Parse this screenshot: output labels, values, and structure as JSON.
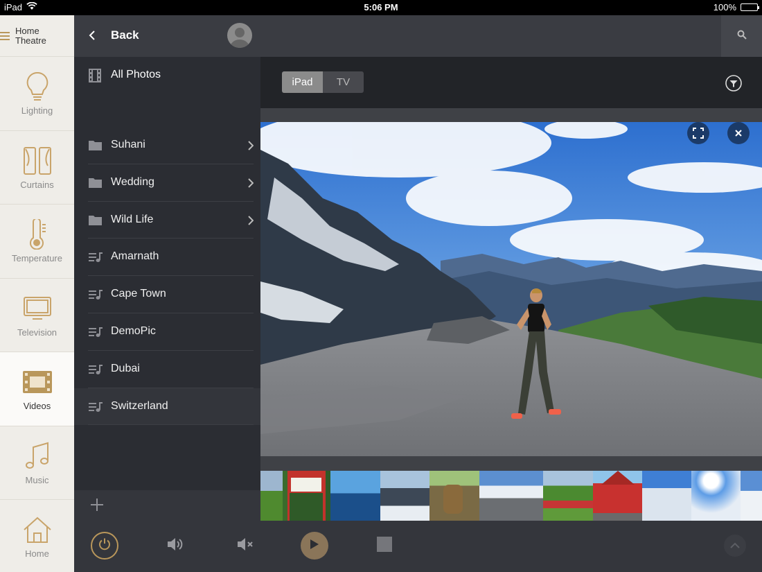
{
  "status_bar": {
    "device": "iPad",
    "time": "5:06 PM",
    "battery": "100%"
  },
  "rail": {
    "home_label": "Home\nTheatre",
    "items": [
      {
        "label": "Lighting",
        "icon": "lightbulb-icon"
      },
      {
        "label": "Curtains",
        "icon": "curtains-icon"
      },
      {
        "label": "Temperature",
        "icon": "thermometer-icon"
      },
      {
        "label": "Television",
        "icon": "television-icon"
      },
      {
        "label": "Videos",
        "icon": "film-icon"
      },
      {
        "label": "Music",
        "icon": "music-note-icon"
      },
      {
        "label": "Home",
        "icon": "home-icon"
      }
    ],
    "active": "Videos"
  },
  "panel": {
    "back_label": "Back",
    "all_photos_label": "All Photos",
    "list": [
      {
        "label": "Suhani",
        "type": "folder",
        "has_children": true
      },
      {
        "label": "Wedding",
        "type": "folder",
        "has_children": true
      },
      {
        "label": "Wild Life",
        "type": "folder",
        "has_children": true
      },
      {
        "label": "Amarnath",
        "type": "playlist",
        "has_children": false
      },
      {
        "label": "Cape Town",
        "type": "playlist",
        "has_children": false
      },
      {
        "label": "DemoPic",
        "type": "playlist",
        "has_children": false
      },
      {
        "label": "Dubai",
        "type": "playlist",
        "has_children": false
      },
      {
        "label": "Switzerland",
        "type": "playlist",
        "has_children": false
      }
    ],
    "selected": "Switzerland"
  },
  "toolbar": {
    "segments": [
      "iPad",
      "TV"
    ],
    "selected_segment": "iPad"
  },
  "colors": {
    "accent": "#b9975b",
    "panel_bg": "#2b2d33",
    "rail_bg": "#efede8"
  }
}
